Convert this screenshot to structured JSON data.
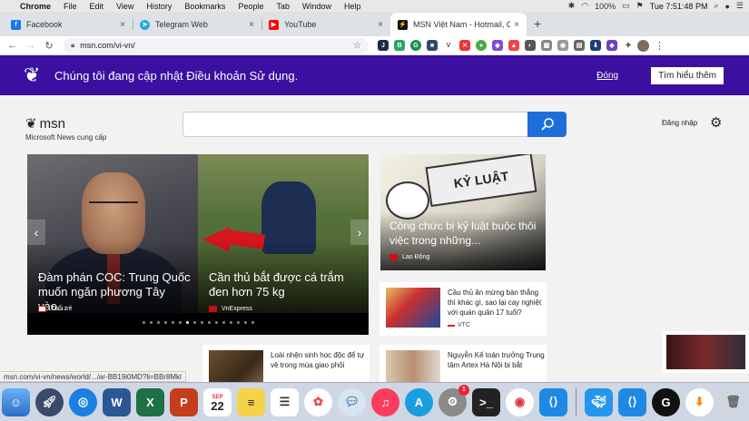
{
  "menubar": {
    "app_name": "Chrome",
    "items": [
      "File",
      "Edit",
      "View",
      "History",
      "Bookmarks",
      "People",
      "Tab",
      "Window",
      "Help"
    ],
    "battery": "100%",
    "clock": "Tue 7:51:48 PM"
  },
  "tabs": [
    {
      "title": "Facebook",
      "icon": "facebook-icon",
      "color": "#1877f2"
    },
    {
      "title": "Telegram Web",
      "icon": "telegram-icon",
      "color": "#2ca5e0"
    },
    {
      "title": "YouTube",
      "icon": "youtube-icon",
      "color": "#ff0000"
    },
    {
      "title": "MSN Việt Nam - Hotmail, Outlo",
      "icon": "msn-icon",
      "color": "#111111"
    }
  ],
  "toolbar": {
    "url": "msn.com/vi-vn/"
  },
  "banner": {
    "message": "Chúng tôi đang cập nhật Điều khoản Sử dụng.",
    "close_label": "Đóng",
    "learn_more_label": "Tìm hiểu thêm",
    "bg_color": "#3b0fa0"
  },
  "header": {
    "logo_text": "msn",
    "logo_sub": "Microsoft News cung cấp",
    "search_placeholder": "",
    "signin_label": "Đăng nhập"
  },
  "hero": {
    "slides": [
      {
        "title": "Đàm phán COC: Trung Quốc muốn ngăn phương Tây vào...",
        "source": "Tuổi trẻ"
      },
      {
        "title": "Cần thủ bắt được cá trắm đen hơn 75 kg",
        "source": "VnExpress"
      }
    ],
    "dot_count": 16,
    "active_dot": 6
  },
  "feature": {
    "title": "Công chức bị kỷ luật buộc thôi việc trong những...",
    "source": "Lao Động",
    "sign_text": "KỶ LUẬT"
  },
  "news": [
    {
      "title": "Cầu thủ ăn mừng bàn thắng thì khác gì, sao lại cay nghiệt với quán quân 17 tuổi?",
      "source": "VTC"
    },
    {
      "title": "Loài nhện sinh học độc để tự vệ trong mùa giao phối",
      "source": ""
    },
    {
      "title": "Nguyễn Kế toán trưởng Trung tâm Artex Hà Nội bị bắt",
      "source": ""
    }
  ],
  "status_url": "msn.com/vi-vn/news/world/.../ar-BB19i0MD?li=BBr8Mkl",
  "dock": {
    "calendar_day": "22",
    "calendar_month": "SEP",
    "badge_count": "1"
  }
}
